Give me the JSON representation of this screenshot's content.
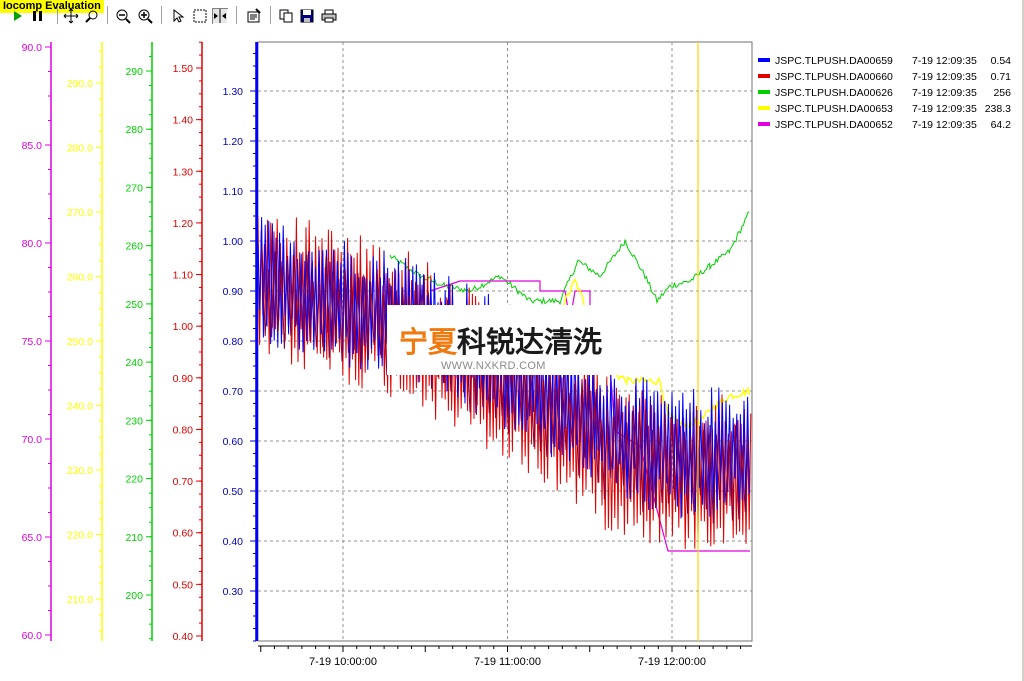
{
  "toolbar": {
    "evaluation_label": "Iocomp Evaluation",
    "buttons": [
      {
        "name": "play-icon"
      },
      {
        "name": "pause-icon"
      },
      {
        "name": "pan-icon"
      },
      {
        "name": "zoom-box-icon"
      },
      {
        "name": "zoom-out-icon"
      },
      {
        "name": "zoom-in-icon"
      },
      {
        "name": "cursor-select-icon"
      },
      {
        "name": "selection-box-icon"
      },
      {
        "name": "data-cursor-icon"
      },
      {
        "name": "properties-icon"
      },
      {
        "name": "copy-icon"
      },
      {
        "name": "save-icon"
      },
      {
        "name": "print-icon"
      }
    ]
  },
  "watermark": {
    "logo_part1": "宁夏",
    "logo_part2": "科锐达清洗",
    "url": "WWW.NXKRD.COM"
  },
  "colors": {
    "magenta": "#e000e0",
    "yellow": "#ffff00",
    "green": "#00d000",
    "red": "#e00000",
    "blue": "#0000e0",
    "grid": "#909090",
    "cursor_line": "#ffd700"
  },
  "chart_data": {
    "type": "line",
    "x_ticks": [
      "7-19 10:00:00",
      "7-19 11:00:00",
      "7-19 12:00:00"
    ],
    "x_range": [
      "7-19 09:29",
      "7-19 12:29"
    ],
    "cursor_time": "7-19 12:09:35",
    "grid": true,
    "legend_position": "top-right",
    "axes": [
      {
        "id": "magenta",
        "color": "#e000e0",
        "ticks": [
          "90.0",
          "85.0",
          "80.0",
          "75.0",
          "70.0",
          "65.0",
          "60.0"
        ],
        "range": [
          60,
          90
        ]
      },
      {
        "id": "yellow",
        "color": "#ffff00",
        "ticks": [
          "290.0",
          "280.0",
          "270.0",
          "260.0",
          "250.0",
          "240.0",
          "230.0",
          "220.0",
          "210.0"
        ],
        "range": [
          205,
          295
        ]
      },
      {
        "id": "green",
        "color": "#00d000",
        "ticks": [
          "290",
          "280",
          "270",
          "260",
          "250",
          "240",
          "230",
          "220",
          "210",
          "200"
        ],
        "range": [
          190,
          297
        ]
      },
      {
        "id": "red",
        "color": "#e00000",
        "ticks": [
          "1.50",
          "1.40",
          "1.30",
          "1.20",
          "1.10",
          "1.00",
          "0.90",
          "0.80",
          "0.70",
          "0.60",
          "0.50",
          "0.40"
        ],
        "range": [
          0.4,
          1.55
        ]
      },
      {
        "id": "blue",
        "color": "#0000c0",
        "ticks": [
          "1.30",
          "1.20",
          "1.10",
          "1.00",
          "0.90",
          "0.80",
          "0.70",
          "0.60",
          "0.50",
          "0.40",
          "0.30"
        ],
        "range": [
          0.2,
          1.4
        ]
      }
    ],
    "series": [
      {
        "name": "JSPC.TLPUSH.DA00659",
        "time": "7-19 12:09:35",
        "value": "0.54",
        "color": "#0000ff",
        "axis": "blue"
      },
      {
        "name": "JSPC.TLPUSH.DA00660",
        "time": "7-19 12:09:35",
        "value": "0.71",
        "color": "#e00000",
        "axis": "red"
      },
      {
        "name": "JSPC.TLPUSH.DA00626",
        "time": "7-19 12:09:35",
        "value": "256",
        "color": "#00d000",
        "axis": "green"
      },
      {
        "name": "JSPC.TLPUSH.DA00653",
        "time": "7-19 12:09:35",
        "value": "238.3",
        "color": "#ffff00",
        "axis": "yellow"
      },
      {
        "name": "JSPC.TLPUSH.DA00652",
        "time": "7-19 12:09:35",
        "value": "64.2",
        "color": "#e000e0",
        "axis": "magenta"
      }
    ]
  }
}
